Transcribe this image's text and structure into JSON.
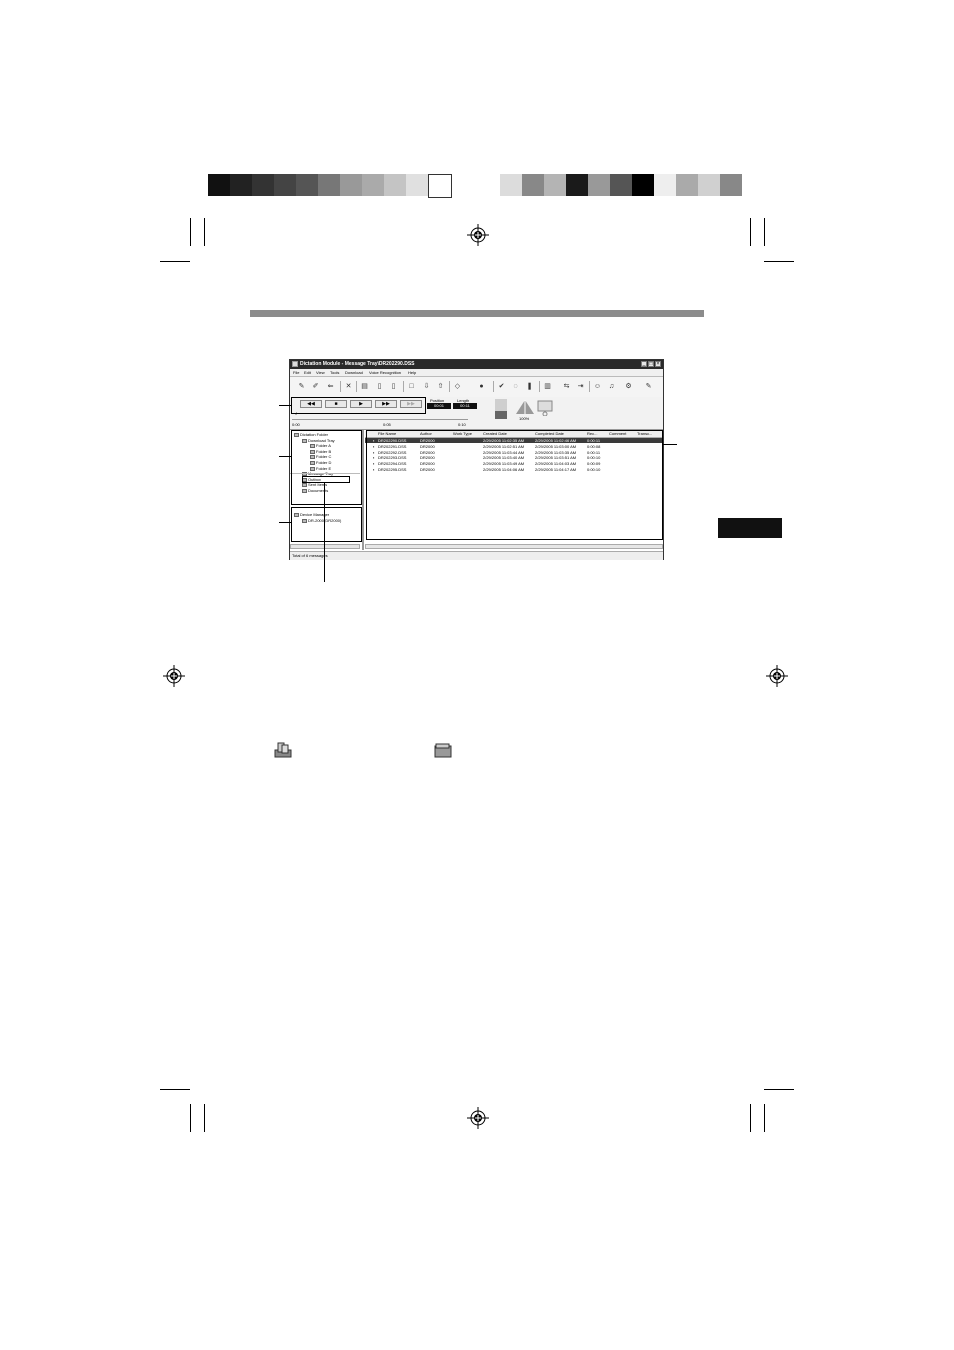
{
  "window": {
    "title": "Dictation Module - Message Tray\\DR202290.DSS",
    "menus": [
      "File",
      "Edit",
      "View",
      "Tools",
      "Download",
      "Voice Recognition",
      "Help"
    ],
    "player": {
      "position_label": "Position",
      "position_value": "00:01",
      "length_label": "Length",
      "length_value": "00:11",
      "scale_start": "0:00",
      "scale_mid": "0:05",
      "scale_end": "0:10",
      "zoom_label": "100%"
    },
    "tree": [
      {
        "label": "Dictation Folder",
        "level": 0
      },
      {
        "label": "Download Tray",
        "level": 1
      },
      {
        "label": "Folder A",
        "level": 2
      },
      {
        "label": "Folder B",
        "level": 2
      },
      {
        "label": "Folder C",
        "level": 2
      },
      {
        "label": "Folder D",
        "level": 2
      },
      {
        "label": "Folder E",
        "level": 2
      },
      {
        "label": "Message Tray",
        "level": 1
      },
      {
        "label": "Outbox",
        "level": 1
      },
      {
        "label": "Sent Items",
        "level": 1
      },
      {
        "label": "Documents",
        "level": 1
      }
    ],
    "device_tree": [
      {
        "label": "Device Manager",
        "level": 0
      },
      {
        "label": "DR-2000(DR2000)",
        "level": 1
      }
    ],
    "columns": [
      "File Name",
      "Author",
      "Work Type",
      "Created Date",
      "Completed Date",
      "Rec...",
      "Comment",
      "Transc..."
    ],
    "rows": [
      {
        "file": "DR202290.DSS",
        "author": "DR2000",
        "work": "",
        "created": "2/29/2005 11:02:35 AM",
        "completed": "2/29/2005 11:02:46 AM",
        "rec": "0:00:11"
      },
      {
        "file": "DR202291.DSS",
        "author": "DR2000",
        "work": "",
        "created": "2/29/2005 11:02:51 AM",
        "completed": "2/29/2005 11:03:00 AM",
        "rec": "0:00:08"
      },
      {
        "file": "DR202292.DSS",
        "author": "DR2000",
        "work": "",
        "created": "2/29/2005 11:03:44 AM",
        "completed": "2/29/2005 11:03:35 AM",
        "rec": "0:00:11"
      },
      {
        "file": "DR202293.DSS",
        "author": "DR2000",
        "work": "",
        "created": "2/29/2005 11:03:40 AM",
        "completed": "2/29/2005 11:03:51 AM",
        "rec": "0:00:10"
      },
      {
        "file": "DR202294.DSS",
        "author": "DR2000",
        "work": "",
        "created": "2/29/2005 11:03:49 AM",
        "completed": "2/29/2005 11:04:03 AM",
        "rec": "0:00:09"
      },
      {
        "file": "DR202295.DSS",
        "author": "DR2000",
        "work": "",
        "created": "2/29/2005 11:04:06 AM",
        "completed": "2/29/2005 11:04:17 AM",
        "rec": "0:00:10"
      }
    ],
    "status": "Total of 6 messages"
  },
  "colors": {
    "calibration_left": [
      "#111111",
      "#222222",
      "#333333",
      "#444444",
      "#555555",
      "#777777",
      "#999999",
      "#aaaaaa",
      "#c4c4c4",
      "#e0e0e0",
      "#ffffff"
    ],
    "calibration_right": [
      "#dcdcdc",
      "#888888",
      "#b4b4b4",
      "#1a1a1a",
      "#999999",
      "#555555",
      "#000000",
      "#eeeeee",
      "#aaaaaa",
      "#d0d0d0",
      "#888888"
    ],
    "top_rule": "#8c8c8c",
    "section_tab": "#111111"
  },
  "icons": [
    "registration-mark-icon",
    "download-tray-icon",
    "folder-icon"
  ]
}
